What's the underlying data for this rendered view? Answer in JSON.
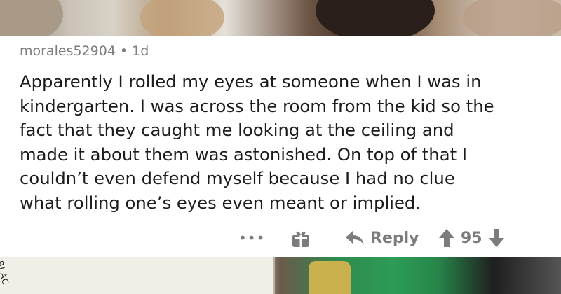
{
  "comment": {
    "username": "morales52904",
    "separator": "•",
    "age": "1d",
    "body_lines": [
      "Apparently I rolled my eyes at someone when I was in",
      "kindergarten. I was across the room from the kid so the",
      "fact that they caught me looking at the ceiling and",
      "made it about them was astonished. On top of that I",
      "couldn’t even defend myself because I had no clue",
      "what rolling one’s eyes even meant or implied."
    ],
    "actions": {
      "more_label": "•••",
      "reply_label": "Reply",
      "score": "95"
    }
  },
  "background": {
    "book_label": "BLAC"
  },
  "colors": {
    "muted": "#7b7c7e",
    "text": "#1c1c1c"
  },
  "icons": {
    "more": "more-options-icon",
    "award": "gift-award-icon",
    "reply": "reply-arrow-icon",
    "upvote": "upvote-arrow-icon",
    "downvote": "downvote-arrow-icon"
  }
}
